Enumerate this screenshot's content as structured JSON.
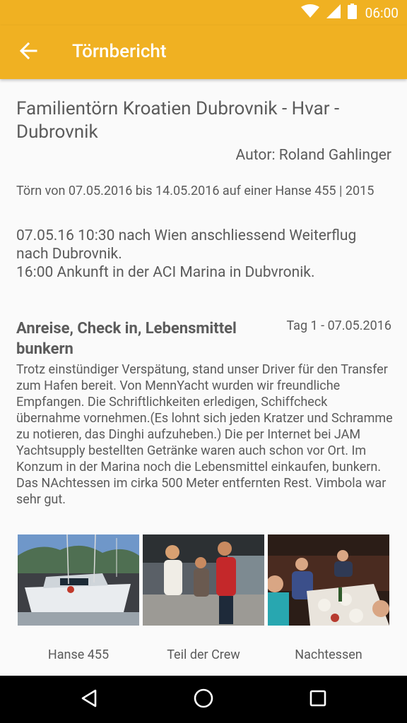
{
  "status_bar": {
    "time": "06:00",
    "icons": [
      "wifi-icon",
      "signal-icon",
      "battery-icon"
    ]
  },
  "app_bar": {
    "title": "Törnbericht",
    "back_icon": "arrow-back-icon",
    "color": "#f0b122"
  },
  "report": {
    "title": "Familientörn Kroatien Dubrovnik - Hvar - Dubrovnik",
    "author": "Autor: Roland Gahlinger",
    "trip_info": "Törn von 07.05.2016 bis 14.05.2016 auf einer Hanse 455 | 2015",
    "intro": "07.05.16 10:30 nach Wien anschliessend Weiterflug nach Dubrovnik.\n16:00 Ankunft in der ACI Marina in Dubvronik."
  },
  "day": {
    "title": "Anreise, Check in, Lebensmittel bunkern",
    "date": "Tag 1 - 07.05.2016",
    "text": "Trotz einstündiger Verspätung, stand unser Driver für den Transfer zum Hafen bereit. Von MennYacht wurden wir freundliche Empfangen. Die Schriftlichkeiten erledigen, Schiffcheck übernahme vornehmen.(Es lohnt sich jeden Kratzer und Schramme zu notieren, das Dinghi aufzuheben.) Die per Internet bei JAM Yachtsupply bestellten Getränke waren auch schon vor Ort. Im Konzum in der Marina noch die Lebensmittel einkaufen, bunkern. Das NAchtessen im cirka 500 Meter entfernten Rest. Vimbola war sehr gut."
  },
  "photos": [
    {
      "caption": "Hanse 455"
    },
    {
      "caption": "Teil der Crew"
    },
    {
      "caption": "Nachtessen"
    }
  ],
  "nav_bar": {
    "buttons": [
      "back-triangle-icon",
      "home-circle-icon",
      "recents-square-icon"
    ]
  }
}
